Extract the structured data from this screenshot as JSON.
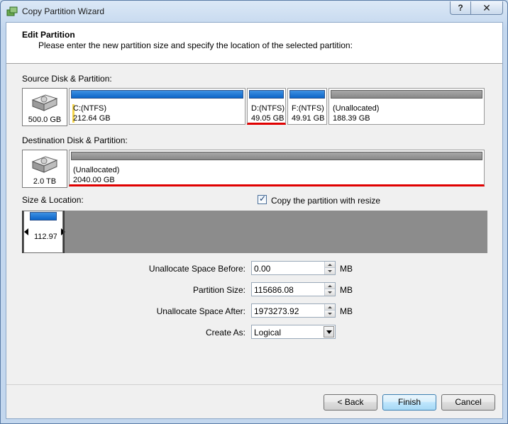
{
  "window": {
    "title": "Copy Partition Wizard",
    "help_label": "?",
    "close_label": "✕"
  },
  "header": {
    "title": "Edit Partition",
    "subtitle": "Please enter the new partition size and specify the location of the selected partition:"
  },
  "source": {
    "label": "Source Disk & Partition:",
    "disk_size": "500.0 GB",
    "partitions": [
      {
        "name": "C:(NTFS)",
        "size": "212.64 GB",
        "type": "ntfs"
      },
      {
        "name": "D:(NTFS)",
        "size": "49.05 GB",
        "type": "ntfs",
        "selected": true
      },
      {
        "name": "F:(NTFS)",
        "size": "49.91 GB",
        "type": "ntfs"
      },
      {
        "name": "(Unallocated)",
        "size": "188.39 GB",
        "type": "unallocated"
      }
    ]
  },
  "destination": {
    "label": "Destination Disk & Partition:",
    "disk_size": "2.0 TB",
    "partition": {
      "name": "(Unallocated)",
      "size": "2040.00 GB"
    }
  },
  "size_location": {
    "label": "Size & Location:",
    "copy_with_resize_label": "Copy the partition with resize",
    "copy_with_resize_checked": true,
    "slider_value": "112.97"
  },
  "fields": {
    "space_before": {
      "label": "Unallocate Space Before:",
      "value": "0.00",
      "unit": "MB"
    },
    "partition_size": {
      "label": "Partition Size:",
      "value": "115686.08",
      "unit": "MB"
    },
    "space_after": {
      "label": "Unallocate Space After:",
      "value": "1973273.92",
      "unit": "MB"
    },
    "create_as": {
      "label": "Create As:",
      "value": "Logical"
    }
  },
  "buttons": {
    "back": "< Back",
    "finish": "Finish",
    "cancel": "Cancel"
  }
}
